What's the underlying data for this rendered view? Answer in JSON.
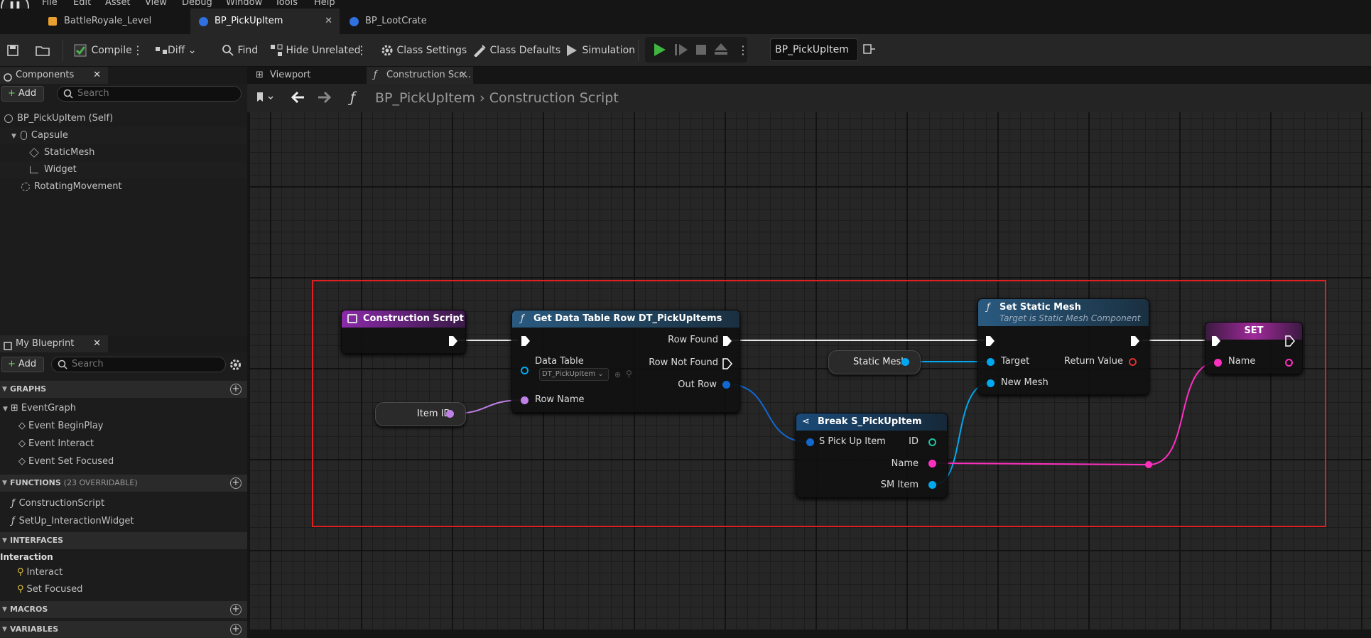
{
  "menu": [
    "File",
    "Edit",
    "Asset",
    "View",
    "Debug",
    "Window",
    "Tools",
    "Help"
  ],
  "tabs": [
    {
      "label": "BattleRoyale_Level",
      "icon": "level-icon"
    },
    {
      "label": "BP_PickUpItem",
      "icon": "blueprint-icon",
      "active": true
    },
    {
      "label": "BP_LootCrate",
      "icon": "blueprint-icon"
    }
  ],
  "toolbar": {
    "compile": "Compile",
    "diff": "Diff",
    "find": "Find",
    "hide_unrelated": "Hide Unrelated",
    "class_settings": "Class Settings",
    "class_defaults": "Class Defaults",
    "simulation": "Simulation",
    "debug_object": "BP_PickUpItem"
  },
  "components": {
    "title": "Components",
    "add": "Add",
    "search_placeholder": "Search",
    "items": [
      "BP_PickUpItem (Self)",
      "Capsule",
      "StaticMesh",
      "Widget",
      "RotatingMovement"
    ]
  },
  "my_blueprint": {
    "title": "My Blueprint",
    "add": "Add",
    "search_placeholder": "Search",
    "graphs_header": "GRAPHS",
    "graphs": [
      "EventGraph",
      "Event BeginPlay",
      "Event Interact",
      "Event Set Focused"
    ],
    "functions_header": "FUNCTIONS",
    "functions_count": "(23 OVERRIDABLE)",
    "functions": [
      "ConstructionScript",
      "SetUp_InteractionWidget"
    ],
    "interfaces_header": "INTERFACES",
    "interface_group": "Interaction",
    "interfaces": [
      "Interact",
      "Set Focused"
    ],
    "macros_header": "MACROS",
    "variables_header": "VARIABLES"
  },
  "graph_tabs": [
    "Viewport",
    "Construction Scr..."
  ],
  "breadcrumb": {
    "blueprint": "BP_PickUpItem",
    "graph": "Construction Script"
  },
  "nodes": {
    "construction": {
      "title": "Construction Script"
    },
    "get_row": {
      "title": "Get Data Table Row DT_PickUpItems",
      "row_found": "Row Found",
      "row_not_found": "Row Not Found",
      "data_table": "Data Table",
      "data_table_value": "DT_PickUpItem",
      "out_row": "Out Row",
      "row_name": "Row Name"
    },
    "item_id": {
      "label": "Item ID"
    },
    "static_mesh_var": {
      "label": "Static Mesh"
    },
    "set_mesh": {
      "title": "Set Static Mesh",
      "subtitle": "Target is Static Mesh Component",
      "target": "Target",
      "new_mesh": "New Mesh",
      "return_value": "Return Value"
    },
    "break": {
      "title": "Break S_PickUpItem",
      "input": "S Pick Up Item",
      "id": "ID",
      "name": "Name",
      "sm_item": "SM Item"
    },
    "set": {
      "title": "SET",
      "name": "Name"
    }
  },
  "colors": {
    "exec": "#ffffff",
    "object": "#00a8f0",
    "name": "#d090ff",
    "text": "#ff40c0",
    "struct": "#0070d0",
    "selection": "#e02020"
  }
}
